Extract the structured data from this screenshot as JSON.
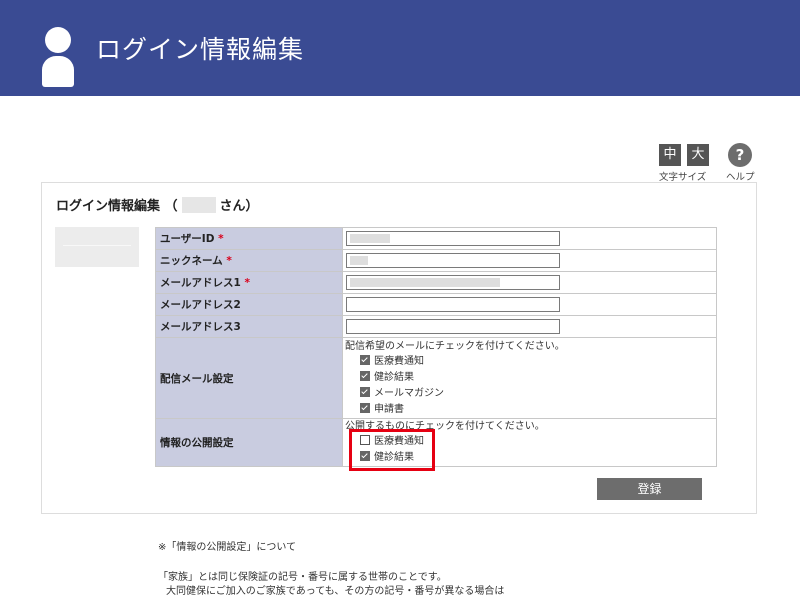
{
  "header": {
    "title": "ログイン情報編集",
    "icon": "user-icon"
  },
  "font_size": {
    "medium": "中",
    "large": "大",
    "label": "文字サイズ"
  },
  "help": {
    "symbol": "?",
    "label": "ヘルプ"
  },
  "panel": {
    "title_prefix": "ログイン情報編集 （",
    "title_suffix": "さん）"
  },
  "fields": {
    "user_id": {
      "label": "ユーザーID",
      "required": "*"
    },
    "nickname": {
      "label": "ニックネーム",
      "required": "*"
    },
    "email1": {
      "label": "メールアドレス1",
      "required": "*"
    },
    "email2": {
      "label": "メールアドレス2"
    },
    "email3": {
      "label": "メールアドレス3"
    }
  },
  "mail_settings": {
    "label": "配信メール設定",
    "note": "配信希望のメールにチェックを付けてください。",
    "options": [
      {
        "label": "医療費通知",
        "checked": true
      },
      {
        "label": "健診結果",
        "checked": true
      },
      {
        "label": "メールマガジン",
        "checked": true
      },
      {
        "label": "申請書",
        "checked": true
      }
    ]
  },
  "publish_settings": {
    "label": "情報の公開設定",
    "note": "公開するものにチェックを付けてください。",
    "options": [
      {
        "label": "医療費通知",
        "checked": false
      },
      {
        "label": "健診結果",
        "checked": true
      }
    ]
  },
  "register_button": "登録",
  "footnotes": {
    "about": "※「情報の公開設定」について",
    "line1": "「家族」とは同じ保険証の記号・番号に属する世帯のことです。",
    "line2": "大同健保にご加入のご家族であっても、その方の記号・番号が異なる場合は"
  },
  "colors": {
    "header": "#3a4b93",
    "label_cell": "#c9cce0",
    "highlight": "#e60012",
    "button": "#6d6d6d"
  }
}
